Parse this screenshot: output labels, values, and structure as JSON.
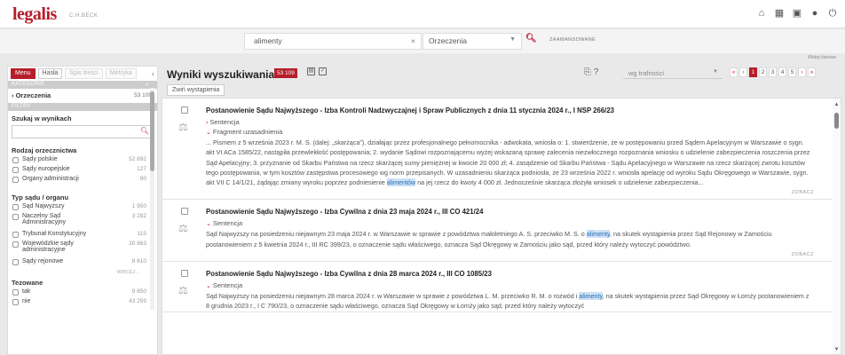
{
  "header": {
    "logo": "legalis",
    "logo_sub": "C.H.BECK",
    "icons": [
      "home-icon",
      "calendar-icon",
      "building-icon",
      "user-icon",
      "power-icon"
    ]
  },
  "search": {
    "query": "alimenty",
    "scope": "Orzeczenia",
    "advanced": "ZAAWANSOWANE"
  },
  "view_link": "Widoj listowe",
  "sidebar": {
    "tabs": [
      "Menu",
      "Hasła",
      "Spis treści",
      "Metryka"
    ],
    "kategorie": "KATEGORIE",
    "filtry": "FILTRY",
    "category": {
      "label": "Orzeczenia",
      "count": "53 109"
    },
    "search_in_results": "Szukaj w wynikach",
    "groups": [
      {
        "title": "Rodzaj orzecznictwa",
        "options": [
          {
            "label": "Sądy polskie",
            "count": "52 892"
          },
          {
            "label": "Sądy europejskie",
            "count": "127"
          },
          {
            "label": "Organy administracji",
            "count": "90"
          }
        ]
      },
      {
        "title": "Typ sądu / organu",
        "options": [
          {
            "label": "Sąd Najwyższy",
            "count": "1 950"
          },
          {
            "label": "Naczelny Sąd Administracyjny",
            "count": "3 282"
          },
          {
            "label": "Trybunał Konstytucyjny",
            "count": "115"
          },
          {
            "label": "Wojewódzkie sądy administracyjne",
            "count": "30 863"
          },
          {
            "label": "Sądy rejonowe",
            "count": "8 610"
          }
        ],
        "more": "WIĘCEJ..."
      },
      {
        "title": "Tezowane",
        "options": [
          {
            "label": "tak",
            "count": "9 850"
          },
          {
            "label": "nie",
            "count": "43 259"
          }
        ]
      }
    ]
  },
  "results": {
    "title": "Wyniki wyszukiwania",
    "count": "53 109",
    "sort": "wg trafności",
    "pages": [
      "«",
      "‹",
      "1",
      "2",
      "3",
      "4",
      "5",
      "›",
      "»"
    ],
    "collapse": "Zwiń wystąpienia",
    "see_more": "ZOBACZ",
    "items": [
      {
        "title": "Postanowienie Sądu Najwyższego - Izba Kontroli Nadzwyczajnej i Spraw Publicznych z dnia 11 stycznia 2024 r., I NSP 266/23",
        "sentencja": "Sentencja",
        "fragment": "Fragment uzasadnienia",
        "text_before": "... Pismem z 5 września 2023 r. M. S. (dalej: „skarżąca”), działając przez profesjonalnego pełnomocnika - adwokata, wniosła o: 1. stwierdzenie, że w postępowaniu przed Sądem Apelacyjnym w Warszawie o sygn. akt VI ACa 1585/22, nastąpiła przewlekłość postępowania; 2. wydanie Sądowi rozpoznającemu wyżej wskazaną sprawę zalecenia niezwłocznego rozpoznania wniosku o udzielenie zabezpieczenia roszczenia przez Sąd Apelacyjny; 3. przyznanie od Skarbu Państwa na rzecz skarżącej sumy pieniężnej w kwocie 20 000 zł; 4. zasądzenie od Skarbu Państwa - Sądu Apelacyjnego w Warszawie na rzecz skarżącej zwrotu kosztów tego postępowania, w tym kosztów zastępstwa procesowego wg norm przepisanych. W uzasadnieniu skarżąca podniosła, że 23 września 2022 r. wniosła apelację od wyroku Sądu Okręgowego w Warszawie, sygn. akt VII C 14/1/21, żądając zmiany wyroku poprzez podniesienie ",
        "highlight": "alimentów",
        "text_after": " na jej rzecz do kwoty 4 000 zł. Jednocześnie skarżąca złożyła wniosek o udzielenie zabezpieczenia..."
      },
      {
        "title": "Postanowienie Sądu Najwyższego - Izba Cywilna z dnia 23 maja 2024 r., III CO 421/24",
        "sentencja": "Sentencja",
        "text_before": "Sąd Najwyższy na posiedzeniu niejawnym 23 maja 2024 r. w Warszawie w sprawie z powództwa małoletniego A. S. przeciwko M. S. o ",
        "highlight": "alimenty",
        "text_after": ", na skutek wystąpienia przez Sąd Rejonowy w Zamościu postanowieniem z 5 kwietnia 2024 r., III RC 399/23, o oznaczenie sądu właściwego, oznacza Sąd Okręgowy w Zamościu jako sąd, przed który należy wytoczyć powództwo."
      },
      {
        "title": "Postanowienie Sądu Najwyższego - Izba Cywilna z dnia 28 marca 2024 r., III CO 1085/23",
        "sentencja": "Sentencja",
        "text_before": "Sąd Najwyższy na posiedzeniu niejawnym 28 marca 2024 r. w Warszawie w sprawie z powództwa L. M. przeciwko R. M. o rozwód i ",
        "highlight": "alimenty",
        "text_after": ", na skutek wystąpienia przez Sąd Okręgowy w Łomży postanowieniem z 8 grudnia 2023 r., I C 790/23, o oznaczenie sądu właściwego, oznacza Sąd Okręgowy w Łomży jako sąd, przed który należy wytoczyć"
      }
    ]
  }
}
